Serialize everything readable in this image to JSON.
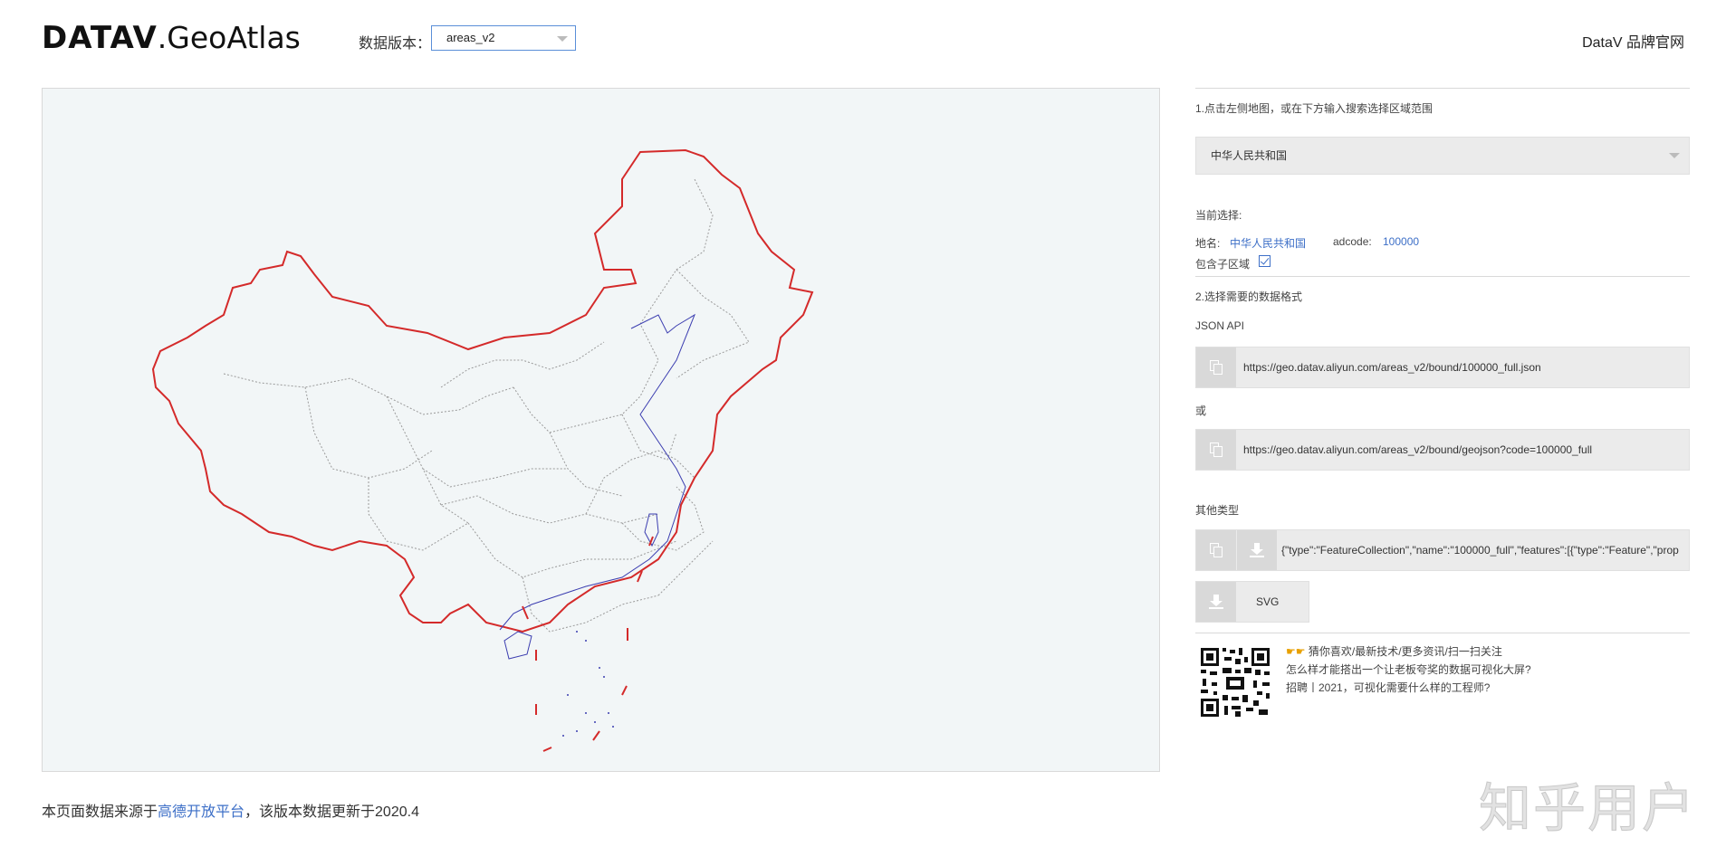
{
  "header": {
    "logo_bold": "DATAV",
    "logo_light": ".GeoAtlas",
    "version_label": "数据版本：",
    "version_value": "areas_v2",
    "brand_link": "DataV 品牌官网"
  },
  "map": {
    "border_color": "#d42a2a",
    "coast_color": "#3b3db0",
    "province_line_color": "#9a9a9a",
    "background": "#f2f6f7"
  },
  "sidebar": {
    "step1": "1.点击左侧地图，或在下方输入搜索选择区域范围",
    "region_value": "中华人民共和国",
    "current_label": "当前选择:",
    "name_label": "地名:",
    "name_value": "中华人民共和国",
    "adcode_label": "adcode:",
    "adcode_value": "100000",
    "include_sub_label": "包含子区域",
    "include_sub_checked": true,
    "step2": "2.选择需要的数据格式",
    "json_api_label": "JSON API",
    "url1": "https://geo.datav.aliyun.com/areas_v2/bound/100000_full.json",
    "or_label": "或",
    "url2": "https://geo.datav.aliyun.com/areas_v2/bound/geojson?code=100000_full",
    "other_types_label": "其他类型",
    "geojson_preview": "{\"type\":\"FeatureCollection\",\"name\":\"100000_full\",\"features\":[{\"type\":\"Feature\",\"prop",
    "svg_label": "SVG",
    "promo": {
      "line1": "猜你喜欢/最新技术/更多资讯/扫一扫关注",
      "line2": "怎么样才能搭出一个让老板夸奖的数据可视化大屏?",
      "line3": "招聘丨2021，可视化需要什么样的工程师?"
    }
  },
  "footer": {
    "prefix": "本页面数据来源于",
    "link": "高德开放平台",
    "suffix": "，该版本数据更新于2020.4"
  },
  "watermark": "知乎用户"
}
